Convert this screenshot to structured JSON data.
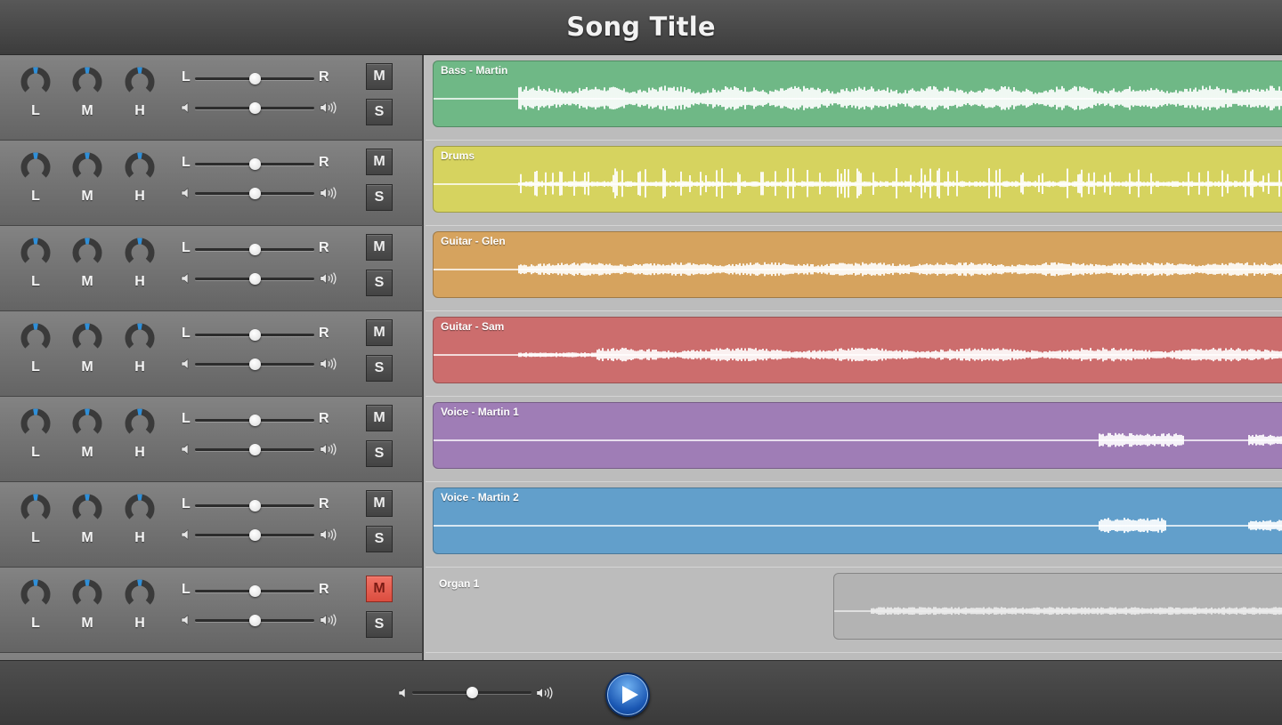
{
  "header": {
    "title": "Song Title"
  },
  "eq_labels": [
    "L",
    "M",
    "H"
  ],
  "pan_labels": {
    "left": "L",
    "right": "R"
  },
  "buttons": {
    "mute": "M",
    "solo": "S"
  },
  "icons": {
    "volume_low": "speaker-low-icon",
    "volume_high": "speaker-high-icon",
    "play": "play-icon"
  },
  "tracks": [
    {
      "name": "Bass - Martin",
      "color": "#76bf8c",
      "clip_color": "#6fb886",
      "muted": false,
      "pan": 0.5,
      "volume": 0.5,
      "clip_start": 0.008,
      "waveform": "bass"
    },
    {
      "name": "Drums",
      "color": "#dcd86a",
      "clip_color": "#d6d35f",
      "muted": false,
      "pan": 0.5,
      "volume": 0.5,
      "clip_start": 0.008,
      "waveform": "drums"
    },
    {
      "name": "Guitar - Glen",
      "color": "#dca964",
      "clip_color": "#d6a35e",
      "muted": false,
      "pan": 0.5,
      "volume": 0.5,
      "clip_start": 0.008,
      "waveform": "guitar1"
    },
    {
      "name": "Guitar - Sam",
      "color": "#d37474",
      "clip_color": "#cc6d6d",
      "muted": false,
      "pan": 0.5,
      "volume": 0.5,
      "clip_start": 0.008,
      "waveform": "guitar2"
    },
    {
      "name": "Voice - Martin 1",
      "color": "#a584bb",
      "clip_color": "#9f7db6",
      "muted": false,
      "pan": 0.5,
      "volume": 0.5,
      "clip_start": 0.008,
      "waveform": "voice1"
    },
    {
      "name": "Voice - Martin 2",
      "color": "#6aa5cf",
      "clip_color": "#629fcb",
      "muted": false,
      "pan": 0.5,
      "volume": 0.5,
      "clip_start": 0.008,
      "waveform": "voice2"
    },
    {
      "name": "Organ 1",
      "color": "#bdbdbd",
      "clip_color": "#b3b3b3",
      "muted": true,
      "pan": 0.5,
      "volume": 0.5,
      "clip_start": 0.476,
      "waveform": "organ"
    }
  ],
  "master": {
    "volume": 0.5
  }
}
